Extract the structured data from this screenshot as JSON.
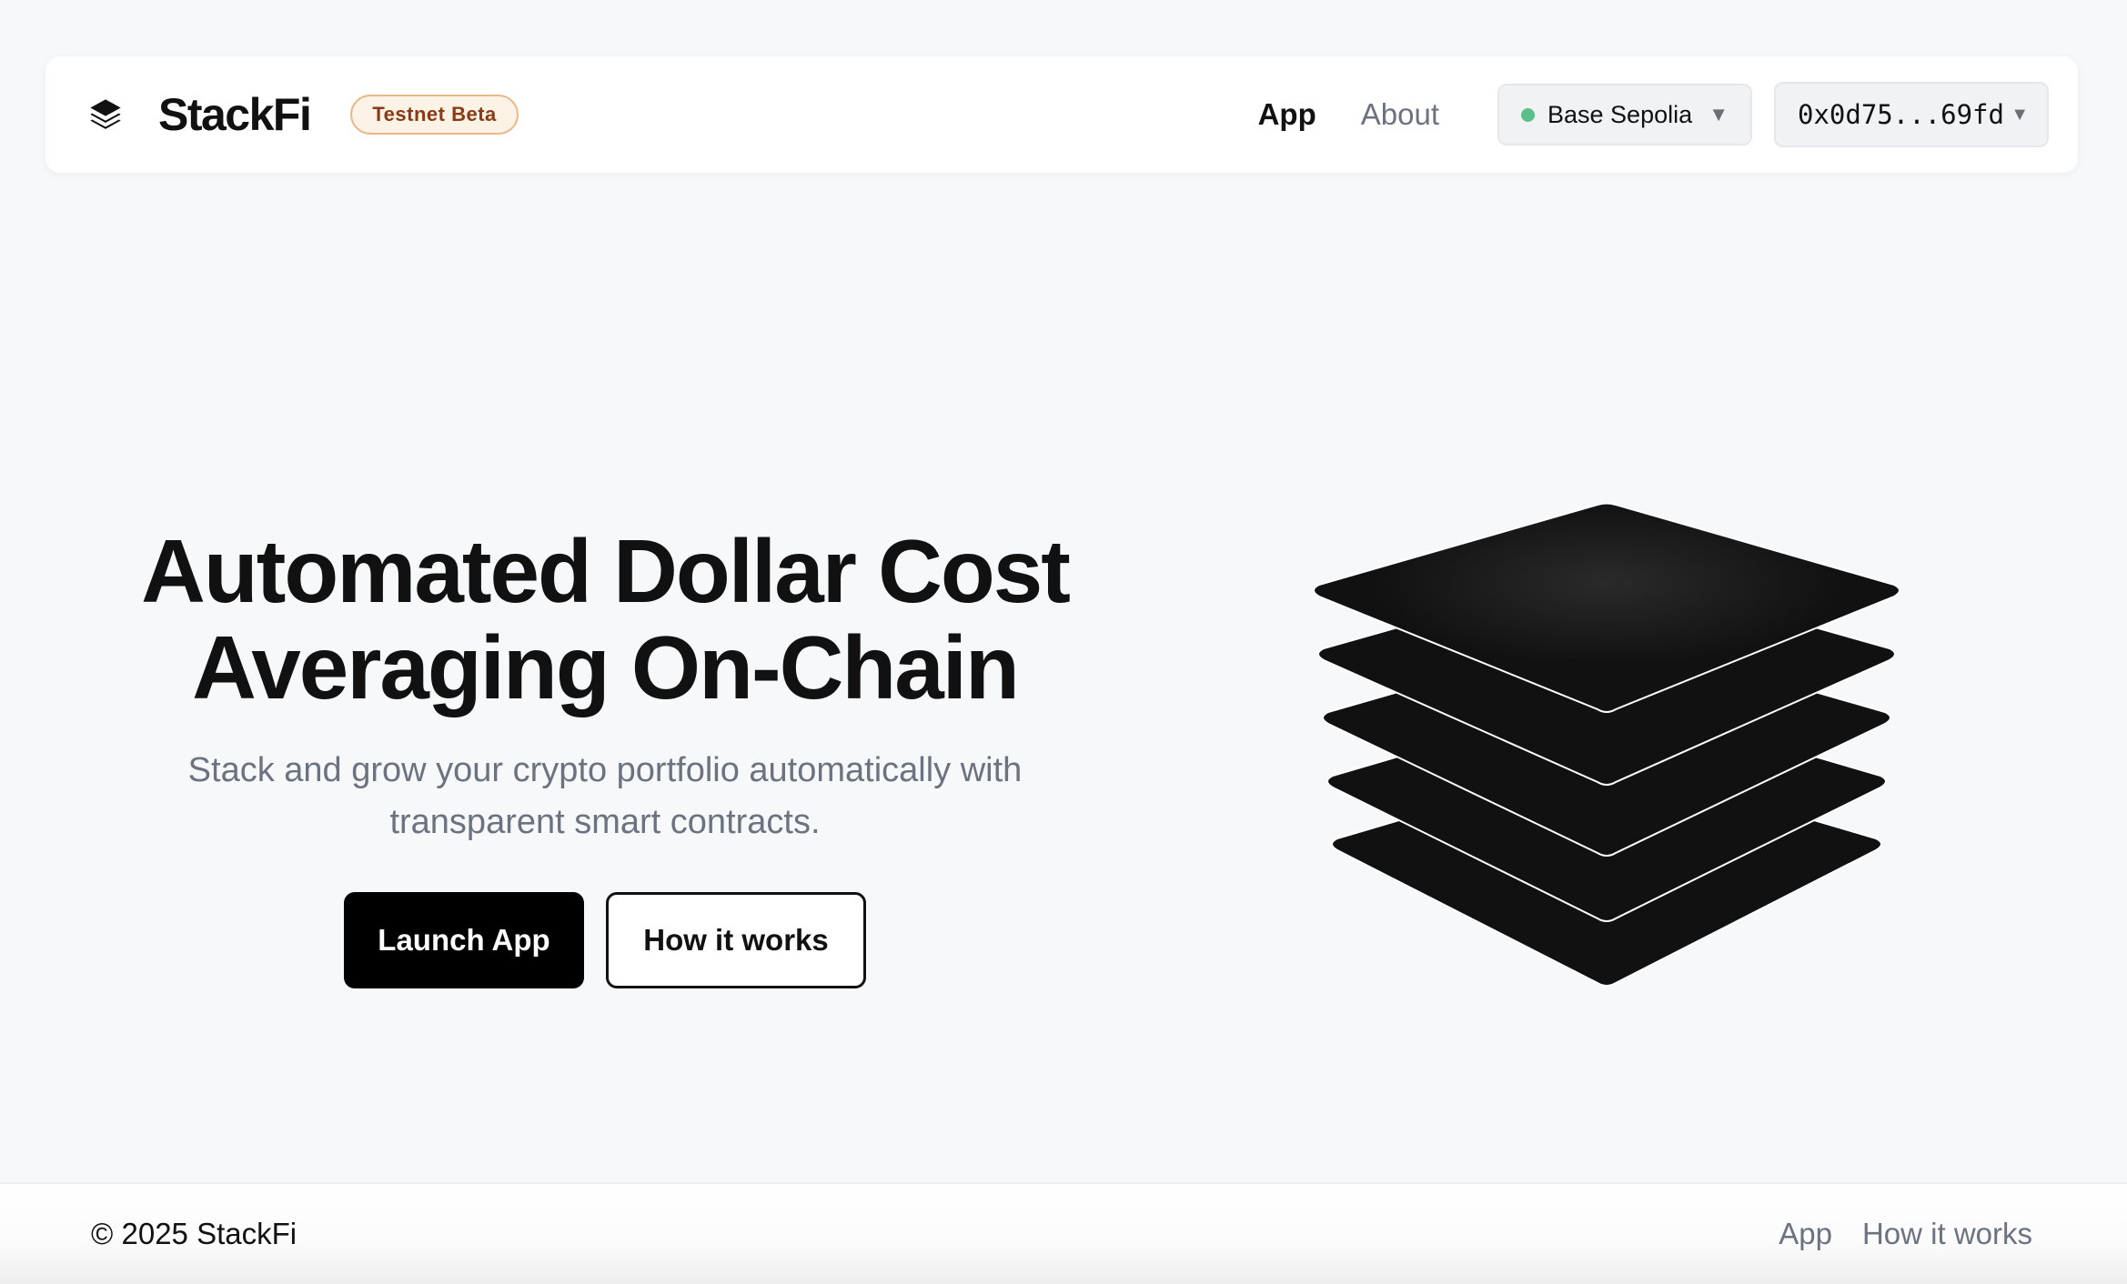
{
  "header": {
    "brand_name": "StackFi",
    "brand_icon": "layers-icon",
    "badge": "Testnet Beta",
    "nav": [
      {
        "label": "App",
        "active": true
      },
      {
        "label": "About",
        "active": false
      }
    ],
    "network": {
      "label": "Base Sepolia",
      "status_color": "#5cc08a",
      "caret": "▼"
    },
    "wallet": {
      "address": "0x0d75...69fd",
      "caret": "▼"
    }
  },
  "hero": {
    "title_line1": "Automated Dollar Cost",
    "title_line2": "Averaging On-Chain",
    "subtitle_line1": "Stack and grow your crypto portfolio automatically with",
    "subtitle_line2": "transparent smart contracts.",
    "primary_button": "Launch App",
    "secondary_button": "How it works",
    "illustration": "stacked-layers-illustration"
  },
  "footer": {
    "copyright": "© 2025 StackFi",
    "links": [
      "App",
      "How it works"
    ]
  },
  "colors": {
    "background": "#f7f8fa",
    "text": "#111111",
    "muted": "#6b7280",
    "badge_bg": "#fdf2e6",
    "badge_border": "#e9b884",
    "badge_text": "#8a3b15",
    "status_green": "#5cc08a"
  }
}
